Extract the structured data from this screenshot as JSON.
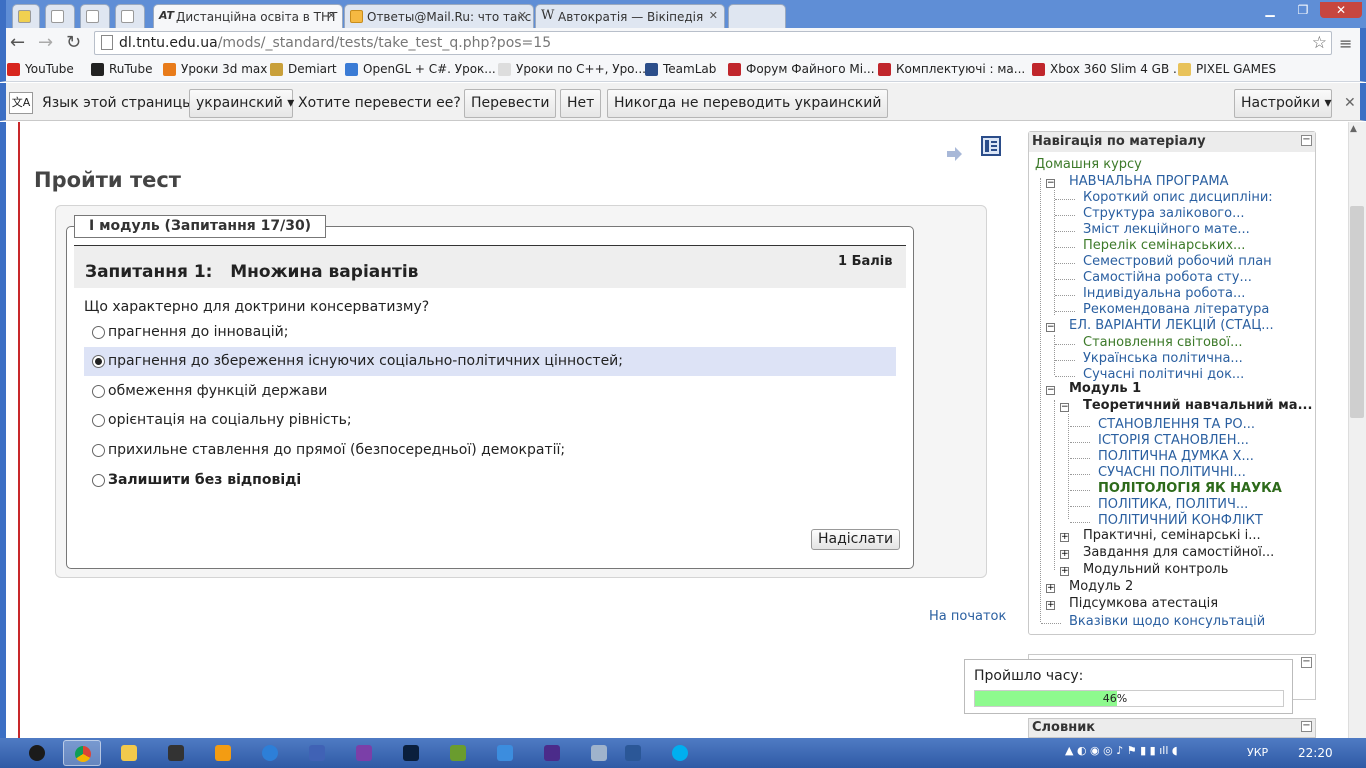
{
  "browser": {
    "tabs": [
      {
        "label": ""
      },
      {
        "label": ""
      },
      {
        "label": ""
      },
      {
        "label": ""
      },
      {
        "label": "Дистанційна освіта в ТНТ"
      },
      {
        "label": "Ответы@Mail.Ru: что такс"
      },
      {
        "label": "Автократія — Вікіпедія"
      }
    ],
    "url_host": "dl.tntu.edu.ua",
    "url_path": "/mods/_standard/tests/take_test_q.php?pos=15",
    "bookmarks": [
      {
        "label": "YouTube",
        "color": "#d7261e"
      },
      {
        "label": "RuTube",
        "color": "#222222"
      },
      {
        "label": "Уроки 3d max",
        "color": "#e87b1a"
      },
      {
        "label": "Demiart",
        "color": "#c9a03a"
      },
      {
        "label": "OpenGL + C#. Урок...",
        "color": "#3a7bd5"
      },
      {
        "label": "Уроки по C++, Уро...",
        "color": "#dddddd"
      },
      {
        "label": "TeamLab",
        "color": "#2c4e8a"
      },
      {
        "label": "Форум Файного Мі...",
        "color": "#c0262c"
      },
      {
        "label": "Комплектуючі : ма...",
        "color": "#c0262c"
      },
      {
        "label": "Xbox 360 Slim 4 GB ...",
        "color": "#c0262c"
      },
      {
        "label": "PIXEL GAMES",
        "color": "#e8c25a"
      }
    ]
  },
  "translate_bar": {
    "prefix": "Язык этой страницы",
    "language": "украинский",
    "question": "Хотите перевести ее?",
    "translate_btn": "Перевести",
    "no_btn": "Нет",
    "never_btn": "Никогда не переводить украинский",
    "settings_btn": "Настройки"
  },
  "page": {
    "title": "Пройти тест",
    "legend": "I модуль (Запитання 17/30)",
    "question_title": "Запитання 1:   Множина варіантів",
    "points": "1 Балів",
    "question_text": "Що характерно для доктрини консерватизму?",
    "options": [
      {
        "label": "прагнення до інновацій;",
        "selected": false
      },
      {
        "label": "прагнення до збереження існуючих соціально-політичних цінностей;",
        "selected": true
      },
      {
        "label": "обмеження функцій держави",
        "selected": false
      },
      {
        "label": "орієнтація на соціальну рівність;",
        "selected": false
      },
      {
        "label": "прихильне ставлення до прямої (безпосередньої) демократії;",
        "selected": false
      },
      {
        "label": "Залишити без відповіді",
        "selected": false
      }
    ],
    "submit": "Надіслати",
    "to_start": "На початок"
  },
  "nav": {
    "heading": "Навігація по матеріалу",
    "home": "Домашня курсу",
    "items": [
      {
        "label": "НАВЧАЛЬНА ПРОГРАМА"
      },
      {
        "label": "Короткий опис дисципліни:"
      },
      {
        "label": "Структура залікового..."
      },
      {
        "label": "Зміст лекційного мате..."
      },
      {
        "label": "Перелік семінарських..."
      },
      {
        "label": "Семестровий робочий план"
      },
      {
        "label": "Самостійна робота сту..."
      },
      {
        "label": "Індивідуальна робота..."
      },
      {
        "label": "Рекомендована література"
      },
      {
        "label": "ЕЛ. ВАРІАНТИ ЛЕКЦІЙ (СТАЦ..."
      },
      {
        "label": "Становлення світової..."
      },
      {
        "label": "Українська політична..."
      },
      {
        "label": "Сучасні політичні док..."
      },
      {
        "label": "Модуль 1"
      },
      {
        "label": "Теоретичний навчальний ма..."
      },
      {
        "label": "СТАНОВЛЕННЯ ТА РО..."
      },
      {
        "label": "ІСТОРІЯ СТАНОВЛЕН..."
      },
      {
        "label": "ПОЛІТИЧНА ДУМКА Х..."
      },
      {
        "label": "СУЧАСНІ ПОЛІТИЧНІ..."
      },
      {
        "label": "ПОЛІТОЛОГІЯ ЯК НАУКА"
      },
      {
        "label": "ПОЛІТИКА, ПОЛІТИЧ..."
      },
      {
        "label": "ПОЛІТИЧНИЙ КОНФЛІКТ"
      },
      {
        "label": "Практичні, семінарські і..."
      },
      {
        "label": "Завдання для самостійної..."
      },
      {
        "label": "Модульний контроль"
      },
      {
        "label": "Модуль 2"
      },
      {
        "label": "Підсумкова атестація"
      },
      {
        "label": "Вказівки щодо консультацій"
      }
    ]
  },
  "timer": {
    "label": "Пройшло часу:",
    "progress": 0.46,
    "progress_text": "46%"
  },
  "dictionary": {
    "heading": "Словник"
  },
  "taskbar": {
    "lang": "УКР",
    "time": "22:20"
  }
}
